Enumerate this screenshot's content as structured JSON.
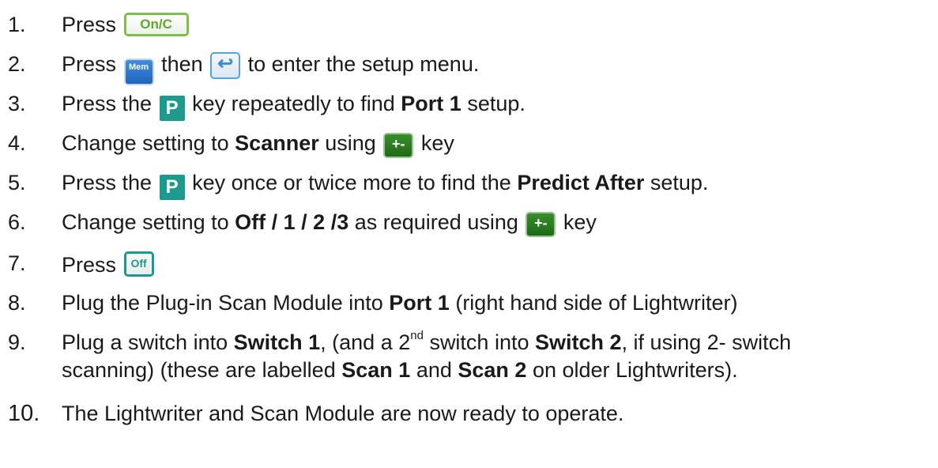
{
  "steps": [
    {
      "number": "1.",
      "parts": [
        "Press"
      ],
      "key": "On/C"
    },
    {
      "number": "2.",
      "parts": [
        "Press",
        "then",
        "to enter the setup menu."
      ],
      "keys": [
        "Mem",
        "↩"
      ]
    },
    {
      "number": "3.",
      "parts": [
        "Press the",
        "key repeatedly to find",
        "Port 1",
        "setup."
      ],
      "key": "P"
    },
    {
      "number": "4.",
      "parts": [
        "Change setting to",
        "Scanner",
        "using",
        "key"
      ],
      "key": "+-"
    },
    {
      "number": "5.",
      "parts": [
        "Press the",
        "key once or twice more to find the",
        "Predict After",
        "setup."
      ],
      "key": "P"
    },
    {
      "number": "6.",
      "parts": [
        "Change setting to",
        "Off / 1 / 2 /3",
        "as required using",
        "key"
      ],
      "key": "+-"
    },
    {
      "number": "7.",
      "parts": [
        "Press"
      ],
      "key": "Off"
    },
    {
      "number": "8.",
      "parts": [
        "Plug the Plug-in Scan Module into",
        "Port 1",
        "(right hand side of Lightwriter)"
      ]
    },
    {
      "number": "9.",
      "parts": [
        "Plug a switch into",
        "Switch 1",
        ", (and a 2",
        "nd",
        "switch into",
        "Switch 2",
        ", if using 2- switch",
        "scanning) (these are labelled",
        "Scan 1",
        "and",
        "Scan 2",
        "on older Lightwriters)."
      ]
    },
    {
      "number": "10.",
      "parts": [
        "The Lightwriter and Scan Module are now ready to operate."
      ]
    }
  ],
  "colors": {
    "onc_key": "#7cc04a",
    "mem_key": "#1f63b8",
    "enter_key": "#3d8ad6",
    "p_key": "#1d9a8e",
    "plus_minus_key": "#2a7a22",
    "off_key": "#1d9a8e",
    "text": "#1a1a1a"
  }
}
